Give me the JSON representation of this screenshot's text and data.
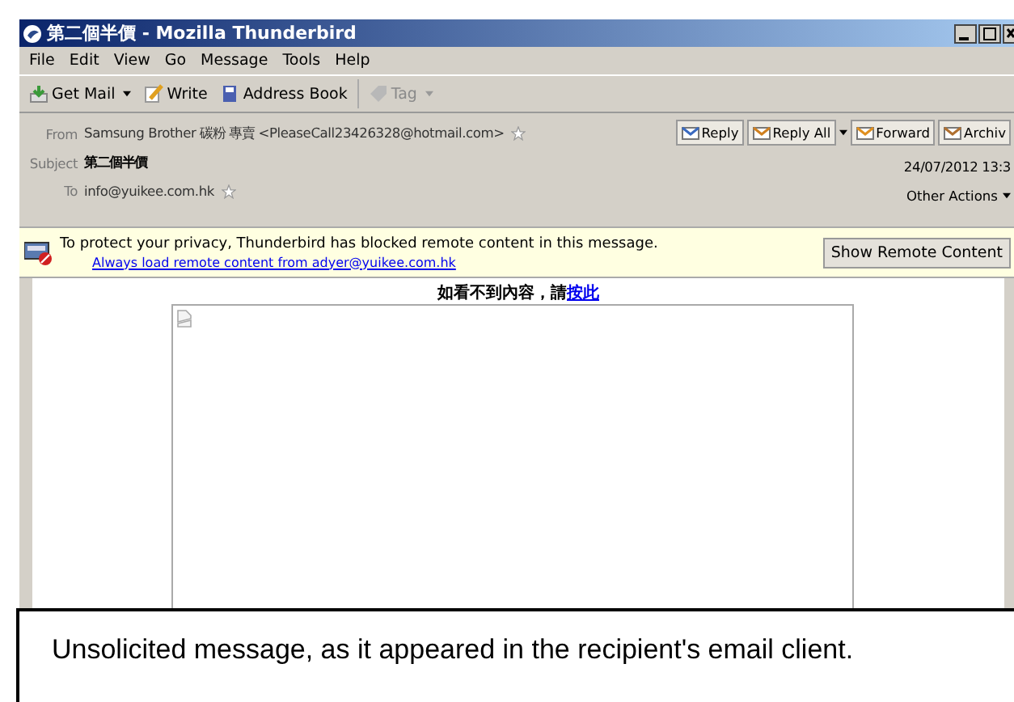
{
  "window": {
    "title": "第二個半價 - Mozilla Thunderbird"
  },
  "menu": [
    "File",
    "Edit",
    "View",
    "Go",
    "Message",
    "Tools",
    "Help"
  ],
  "toolbar": [
    {
      "label": "Get Mail",
      "kind": "getmail",
      "dropdown": true,
      "disabled": false
    },
    {
      "label": "Write",
      "kind": "write",
      "dropdown": false,
      "disabled": false
    },
    {
      "label": "Address Book",
      "kind": "book",
      "dropdown": false,
      "disabled": false
    },
    {
      "label": "Tag",
      "kind": "tag",
      "dropdown": true,
      "disabled": true
    }
  ],
  "header": {
    "from_label": "From",
    "from": "Samsung Brother 碳粉 專賣 <PleaseCall23426328@hotmail.com>",
    "subject_label": "Subject",
    "subject": "第二個半價",
    "to_label": "To",
    "to": "info@yuikee.com.hk",
    "date": "24/07/2012 13:3",
    "other_actions": "Other Actions",
    "actions": [
      {
        "label": "Reply",
        "kind": "reply",
        "dropdown": false
      },
      {
        "label": "Reply All",
        "kind": "replyall",
        "dropdown": true
      },
      {
        "label": "Forward",
        "kind": "forward",
        "dropdown": false
      },
      {
        "label": "Archiv",
        "kind": "archive",
        "dropdown": false
      }
    ]
  },
  "notice": {
    "message": "To protect your privacy, Thunderbird has blocked remote content in this message.",
    "link": "Always load remote content from adyer@yuikee.com.hk",
    "button": "Show Remote Content"
  },
  "body": {
    "text": "如看不到內容，請",
    "link": "按此"
  },
  "caption": "Unsolicited message, as it appeared in the recipient's email client."
}
